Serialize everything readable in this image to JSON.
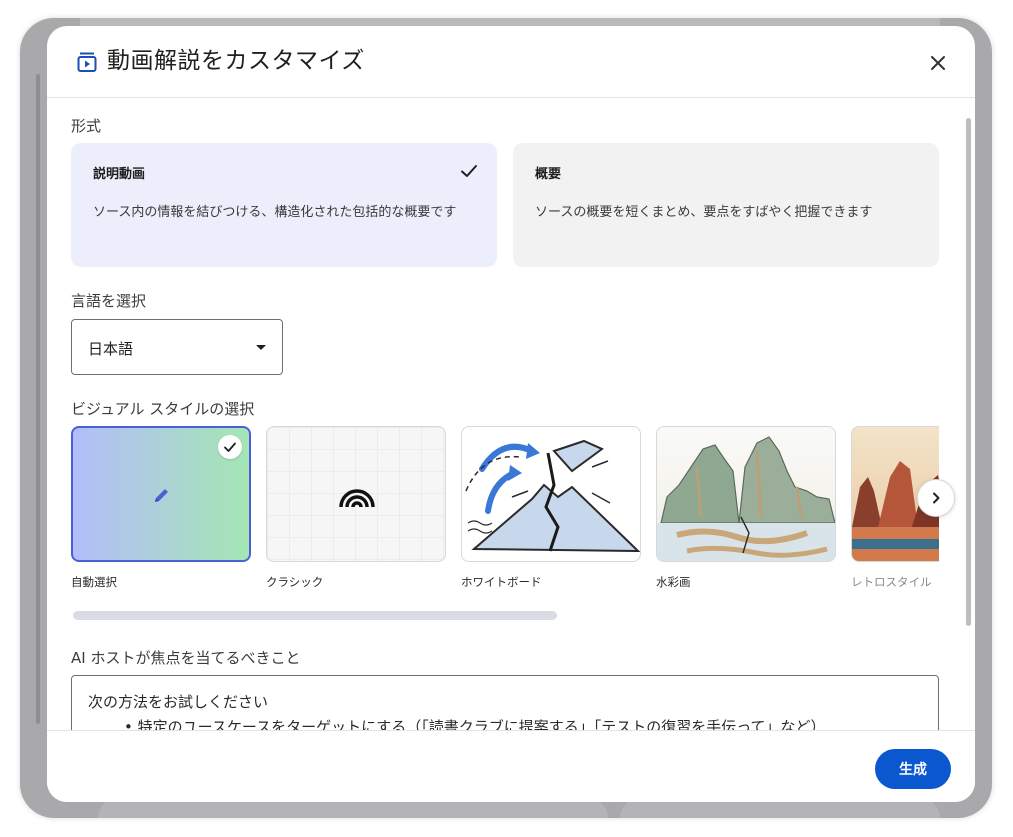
{
  "dialog": {
    "title": "動画解説をカスタマイズ",
    "title_icon": "video-overview-icon",
    "close_icon": "close-icon"
  },
  "format": {
    "label": "形式",
    "options": [
      {
        "title": "説明動画",
        "description": "ソース内の情報を結びつける、構造化された包括的な概要です",
        "selected": true
      },
      {
        "title": "概要",
        "description": "ソースの概要を短くまとめ、要点をすばやく把握できます",
        "selected": false
      }
    ]
  },
  "language": {
    "label": "言語を選択",
    "value": "日本語"
  },
  "visual_style": {
    "label": "ビジュアル スタイルの選択",
    "items": [
      {
        "label": "自動選択",
        "icon": "pencil-icon",
        "selected": true
      },
      {
        "label": "クラシック",
        "icon": "rainbow-icon",
        "selected": false
      },
      {
        "label": "ホワイトボード",
        "icon": "volcano-sketch-image",
        "selected": false
      },
      {
        "label": "水彩画",
        "icon": "watercolor-landscape-image",
        "selected": false
      },
      {
        "label": "レトロスタイル",
        "icon": "retro-canyon-image",
        "selected": false
      }
    ],
    "next_icon": "chevron-right-icon"
  },
  "focus": {
    "label": "AI ホストが焦点を当てるべきこと",
    "intro": "次の方法をお試しください",
    "bullet": "• 特定のユースケースをターゲットにする（「読書クラブに提案する」「テストの復習を手伝って」など）"
  },
  "footer": {
    "generate_label": "生成"
  },
  "colors": {
    "accent": "#0b57d0",
    "selected_card": "#eceefb",
    "selected_border": "#4d5fd6"
  }
}
